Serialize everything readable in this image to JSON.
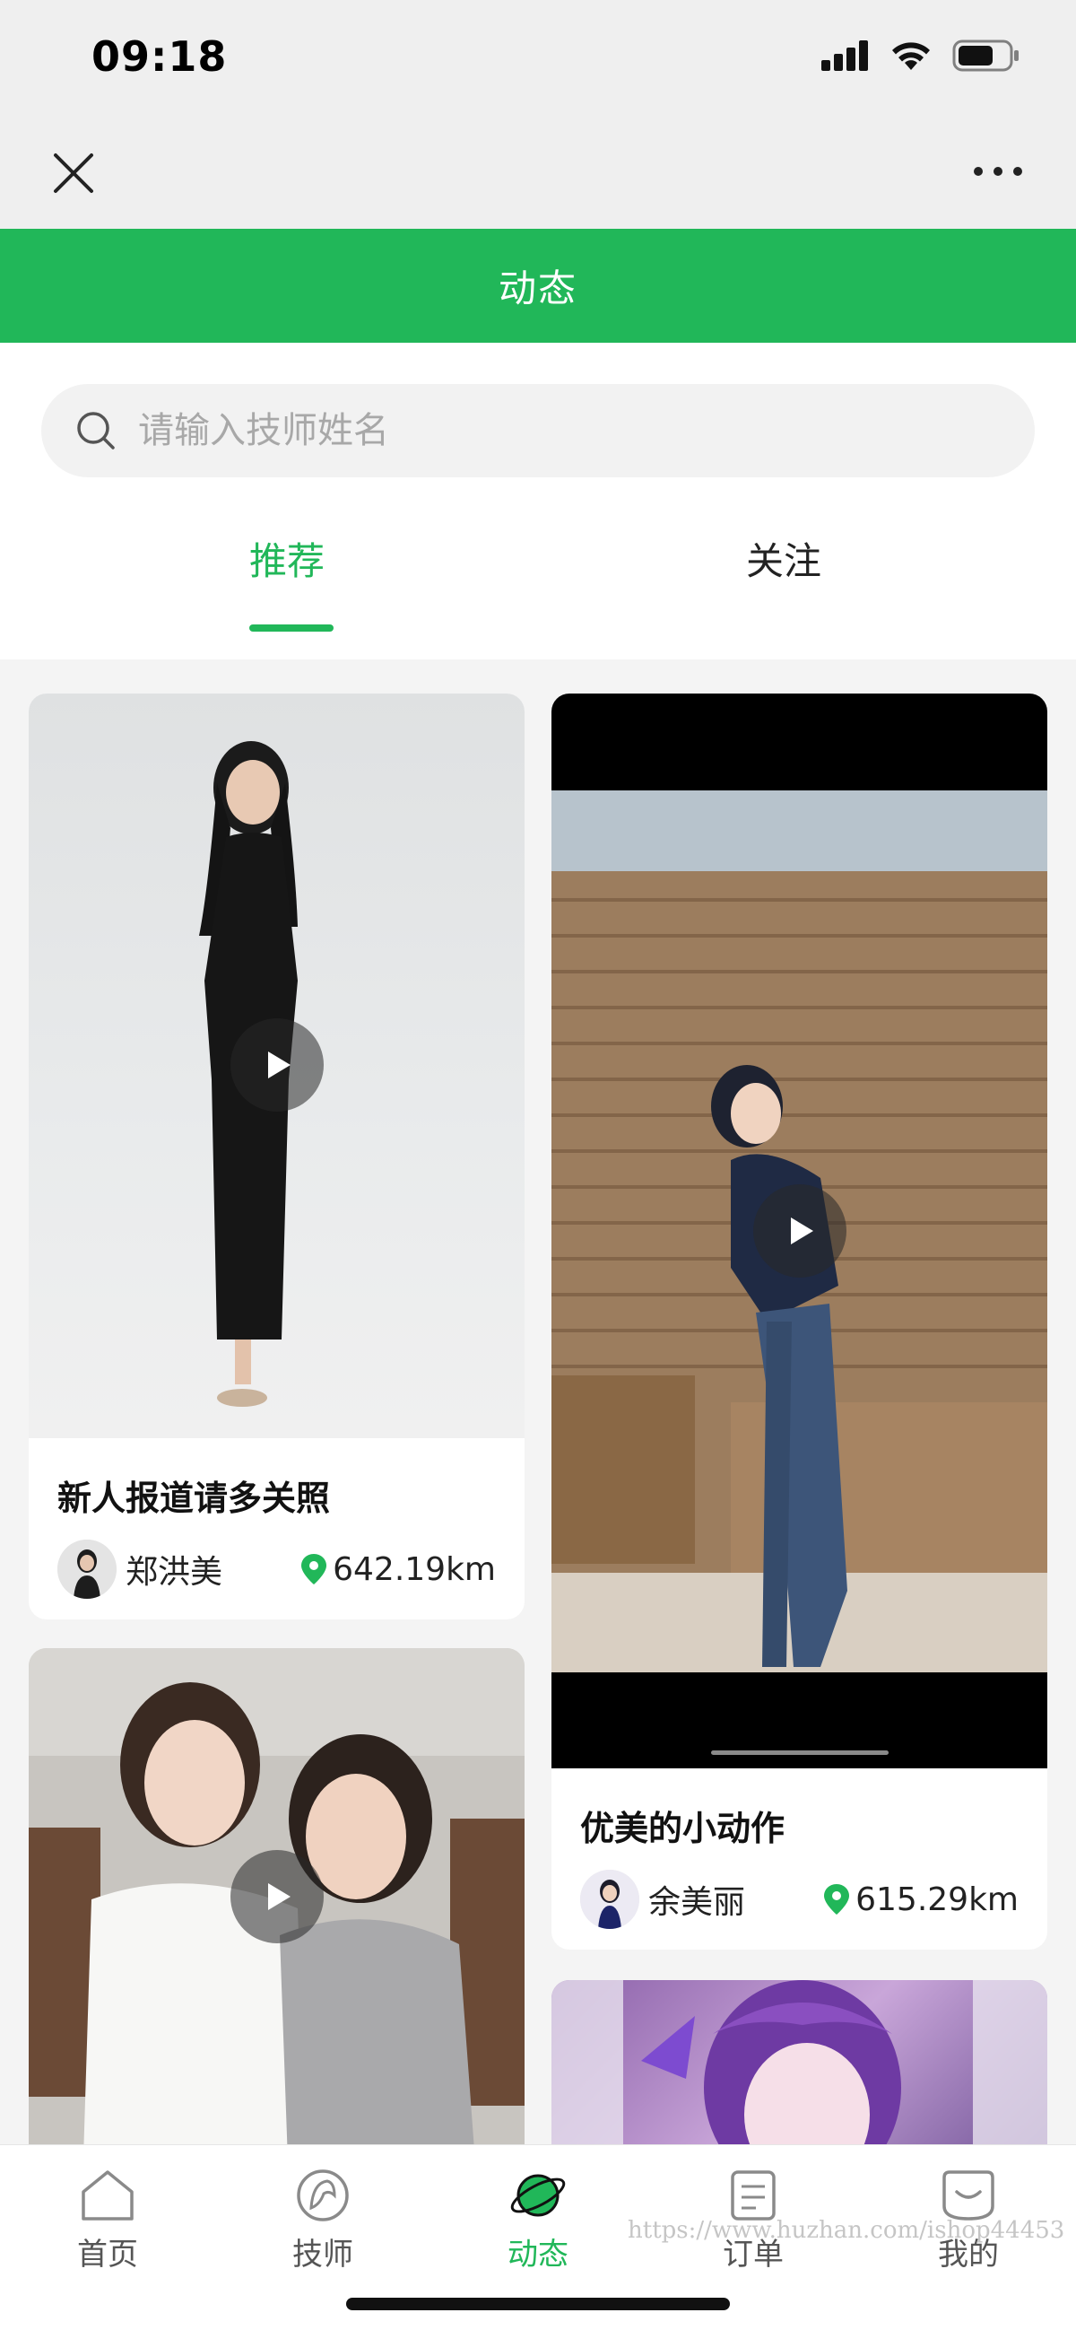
{
  "status_bar": {
    "time": "09:18"
  },
  "header": {
    "title": "动态"
  },
  "search": {
    "placeholder": "请输入技师姓名"
  },
  "tabs": [
    {
      "label": "推荐",
      "active": true
    },
    {
      "label": "关注",
      "active": false
    }
  ],
  "posts": [
    {
      "title": "新人报道请多关照",
      "author": "郑洪美",
      "distance": "642.19km"
    },
    {
      "title": "优美的小动作",
      "author": "余美丽",
      "distance": "615.29km"
    }
  ],
  "bottom_nav": [
    {
      "label": "首页",
      "icon": "home-icon"
    },
    {
      "label": "技师",
      "icon": "technician-icon"
    },
    {
      "label": "动态",
      "icon": "planet-icon",
      "active": true
    },
    {
      "label": "订单",
      "icon": "order-icon"
    },
    {
      "label": "我的",
      "icon": "profile-icon"
    }
  ],
  "watermark": "https://www.huzhan.com/ishop44453",
  "colors": {
    "accent": "#21b759",
    "background": "#f4f4f4"
  }
}
